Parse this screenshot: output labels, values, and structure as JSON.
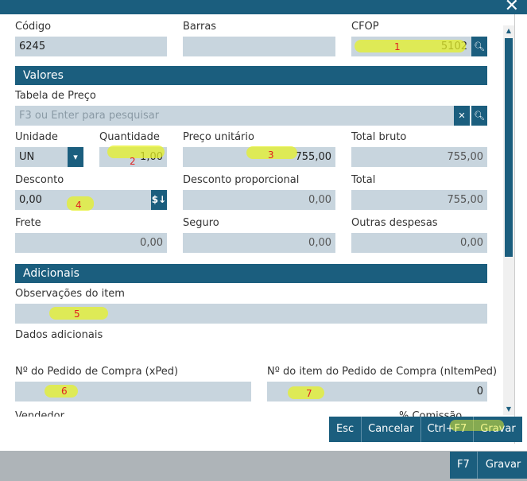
{
  "window": {
    "close_icon": "close-icon"
  },
  "fields": {
    "codigo_label": "Código",
    "codigo_value": "6245",
    "barras_label": "Barras",
    "cfop_label": "CFOP",
    "cfop_value": "5102",
    "tabela_label": "Tabela de Preço",
    "tabela_placeholder": "F3 ou Enter para pesquisar",
    "unidade_label": "Unidade",
    "unidade_value": "UN",
    "quantidade_label": "Quantidade",
    "quantidade_value": "1,00",
    "preco_label": "Preço unitário",
    "preco_value": "755,00",
    "total_bruto_label": "Total bruto",
    "total_bruto_value": "755,00",
    "desconto_label": "Desconto",
    "desconto_value": "0,00",
    "desconto_prop_label": "Desconto proporcional",
    "desconto_prop_value": "0,00",
    "total_label": "Total",
    "total_value": "755,00",
    "frete_label": "Frete",
    "frete_value": "0,00",
    "seguro_label": "Seguro",
    "seguro_value": "0,00",
    "outras_label": "Outras despesas",
    "outras_value": "0,00",
    "obs_label": "Observações do item",
    "dados_label": "Dados adicionais",
    "xped_label": "Nº do Pedido de Compra (xPed)",
    "nitem_label": "Nº do item do Pedido de Compra (nItemPed)",
    "nitem_value": "0",
    "cutoff_left": "Vendedor",
    "cutoff_right": "% Comissão"
  },
  "sections": {
    "valores": "Valores",
    "adicionais": "Adicionais"
  },
  "annotations": [
    "1",
    "2",
    "3",
    "4",
    "5",
    "6",
    "7"
  ],
  "buttons": {
    "esc": "Esc",
    "cancelar": "Cancelar",
    "ctrl_f7": "Ctrl+F7",
    "gravar": "Gravar"
  },
  "footer": {
    "key": "F7",
    "label": "Gravar"
  }
}
